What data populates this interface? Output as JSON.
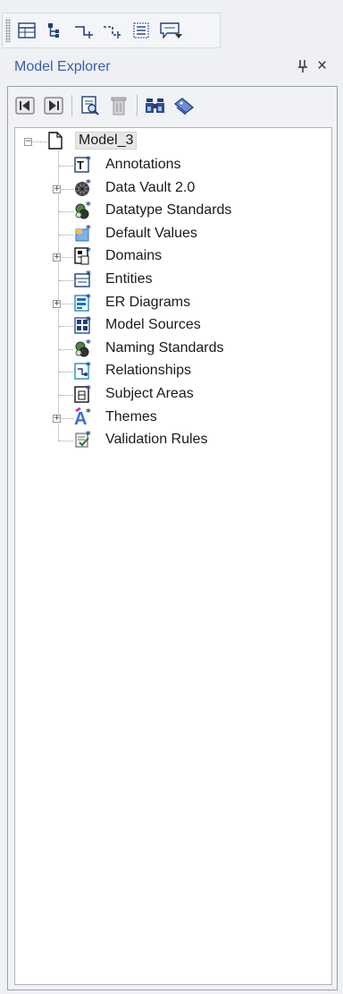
{
  "panel": {
    "title": "Model Explorer",
    "pin_glyph": "٨",
    "close_glyph": "×"
  },
  "toolbar_top": {
    "buttons": [
      "table-icon",
      "tree-icon",
      "relationship-icon",
      "relationship-dashed-icon",
      "list-icon",
      "comment-icon"
    ]
  },
  "panel_tools": {
    "buttons": [
      "back-icon",
      "forward-icon",
      "properties-icon",
      "delete-icon",
      "find-icon",
      "tag-icon"
    ]
  },
  "tree": {
    "root": {
      "label": "Model_3",
      "expanded": true
    },
    "items": [
      {
        "label": "Annotations",
        "icon": "annotation-icon",
        "expandable": false
      },
      {
        "label": "Data Vault 2.0",
        "icon": "data-vault-icon",
        "expandable": true
      },
      {
        "label": "Datatype Standards",
        "icon": "datatype-standards-icon",
        "expandable": false
      },
      {
        "label": "Default Values",
        "icon": "default-values-icon",
        "expandable": false
      },
      {
        "label": "Domains",
        "icon": "domains-icon",
        "expandable": true
      },
      {
        "label": "Entities",
        "icon": "entities-icon",
        "expandable": false
      },
      {
        "label": "ER Diagrams",
        "icon": "er-diagrams-icon",
        "expandable": true
      },
      {
        "label": "Model Sources",
        "icon": "model-sources-icon",
        "expandable": false
      },
      {
        "label": "Naming Standards",
        "icon": "naming-standards-icon",
        "expandable": false
      },
      {
        "label": "Relationships",
        "icon": "relationships-icon",
        "expandable": false
      },
      {
        "label": "Subject Areas",
        "icon": "subject-areas-icon",
        "expandable": false
      },
      {
        "label": "Themes",
        "icon": "themes-icon",
        "expandable": true
      },
      {
        "label": "Validation Rules",
        "icon": "validation-rules-icon",
        "expandable": false
      }
    ]
  }
}
